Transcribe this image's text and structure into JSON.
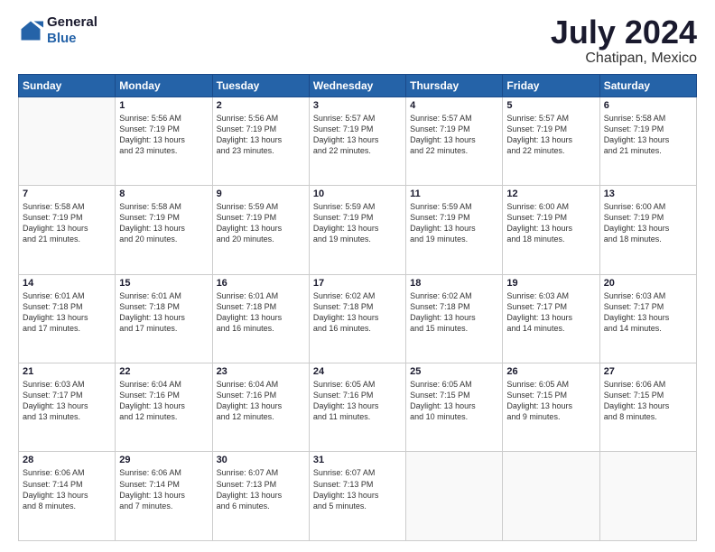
{
  "header": {
    "logo_line1": "General",
    "logo_line2": "Blue",
    "title": "July 2024",
    "subtitle": "Chatipan, Mexico"
  },
  "days_of_week": [
    "Sunday",
    "Monday",
    "Tuesday",
    "Wednesday",
    "Thursday",
    "Friday",
    "Saturday"
  ],
  "weeks": [
    [
      {
        "day": "",
        "info": ""
      },
      {
        "day": "1",
        "info": "Sunrise: 5:56 AM\nSunset: 7:19 PM\nDaylight: 13 hours\nand 23 minutes."
      },
      {
        "day": "2",
        "info": "Sunrise: 5:56 AM\nSunset: 7:19 PM\nDaylight: 13 hours\nand 23 minutes."
      },
      {
        "day": "3",
        "info": "Sunrise: 5:57 AM\nSunset: 7:19 PM\nDaylight: 13 hours\nand 22 minutes."
      },
      {
        "day": "4",
        "info": "Sunrise: 5:57 AM\nSunset: 7:19 PM\nDaylight: 13 hours\nand 22 minutes."
      },
      {
        "day": "5",
        "info": "Sunrise: 5:57 AM\nSunset: 7:19 PM\nDaylight: 13 hours\nand 22 minutes."
      },
      {
        "day": "6",
        "info": "Sunrise: 5:58 AM\nSunset: 7:19 PM\nDaylight: 13 hours\nand 21 minutes."
      }
    ],
    [
      {
        "day": "7",
        "info": "Sunrise: 5:58 AM\nSunset: 7:19 PM\nDaylight: 13 hours\nand 21 minutes."
      },
      {
        "day": "8",
        "info": "Sunrise: 5:58 AM\nSunset: 7:19 PM\nDaylight: 13 hours\nand 20 minutes."
      },
      {
        "day": "9",
        "info": "Sunrise: 5:59 AM\nSunset: 7:19 PM\nDaylight: 13 hours\nand 20 minutes."
      },
      {
        "day": "10",
        "info": "Sunrise: 5:59 AM\nSunset: 7:19 PM\nDaylight: 13 hours\nand 19 minutes."
      },
      {
        "day": "11",
        "info": "Sunrise: 5:59 AM\nSunset: 7:19 PM\nDaylight: 13 hours\nand 19 minutes."
      },
      {
        "day": "12",
        "info": "Sunrise: 6:00 AM\nSunset: 7:19 PM\nDaylight: 13 hours\nand 18 minutes."
      },
      {
        "day": "13",
        "info": "Sunrise: 6:00 AM\nSunset: 7:19 PM\nDaylight: 13 hours\nand 18 minutes."
      }
    ],
    [
      {
        "day": "14",
        "info": "Sunrise: 6:01 AM\nSunset: 7:18 PM\nDaylight: 13 hours\nand 17 minutes."
      },
      {
        "day": "15",
        "info": "Sunrise: 6:01 AM\nSunset: 7:18 PM\nDaylight: 13 hours\nand 17 minutes."
      },
      {
        "day": "16",
        "info": "Sunrise: 6:01 AM\nSunset: 7:18 PM\nDaylight: 13 hours\nand 16 minutes."
      },
      {
        "day": "17",
        "info": "Sunrise: 6:02 AM\nSunset: 7:18 PM\nDaylight: 13 hours\nand 16 minutes."
      },
      {
        "day": "18",
        "info": "Sunrise: 6:02 AM\nSunset: 7:18 PM\nDaylight: 13 hours\nand 15 minutes."
      },
      {
        "day": "19",
        "info": "Sunrise: 6:03 AM\nSunset: 7:17 PM\nDaylight: 13 hours\nand 14 minutes."
      },
      {
        "day": "20",
        "info": "Sunrise: 6:03 AM\nSunset: 7:17 PM\nDaylight: 13 hours\nand 14 minutes."
      }
    ],
    [
      {
        "day": "21",
        "info": "Sunrise: 6:03 AM\nSunset: 7:17 PM\nDaylight: 13 hours\nand 13 minutes."
      },
      {
        "day": "22",
        "info": "Sunrise: 6:04 AM\nSunset: 7:16 PM\nDaylight: 13 hours\nand 12 minutes."
      },
      {
        "day": "23",
        "info": "Sunrise: 6:04 AM\nSunset: 7:16 PM\nDaylight: 13 hours\nand 12 minutes."
      },
      {
        "day": "24",
        "info": "Sunrise: 6:05 AM\nSunset: 7:16 PM\nDaylight: 13 hours\nand 11 minutes."
      },
      {
        "day": "25",
        "info": "Sunrise: 6:05 AM\nSunset: 7:15 PM\nDaylight: 13 hours\nand 10 minutes."
      },
      {
        "day": "26",
        "info": "Sunrise: 6:05 AM\nSunset: 7:15 PM\nDaylight: 13 hours\nand 9 minutes."
      },
      {
        "day": "27",
        "info": "Sunrise: 6:06 AM\nSunset: 7:15 PM\nDaylight: 13 hours\nand 8 minutes."
      }
    ],
    [
      {
        "day": "28",
        "info": "Sunrise: 6:06 AM\nSunset: 7:14 PM\nDaylight: 13 hours\nand 8 minutes."
      },
      {
        "day": "29",
        "info": "Sunrise: 6:06 AM\nSunset: 7:14 PM\nDaylight: 13 hours\nand 7 minutes."
      },
      {
        "day": "30",
        "info": "Sunrise: 6:07 AM\nSunset: 7:13 PM\nDaylight: 13 hours\nand 6 minutes."
      },
      {
        "day": "31",
        "info": "Sunrise: 6:07 AM\nSunset: 7:13 PM\nDaylight: 13 hours\nand 5 minutes."
      },
      {
        "day": "",
        "info": ""
      },
      {
        "day": "",
        "info": ""
      },
      {
        "day": "",
        "info": ""
      }
    ]
  ]
}
